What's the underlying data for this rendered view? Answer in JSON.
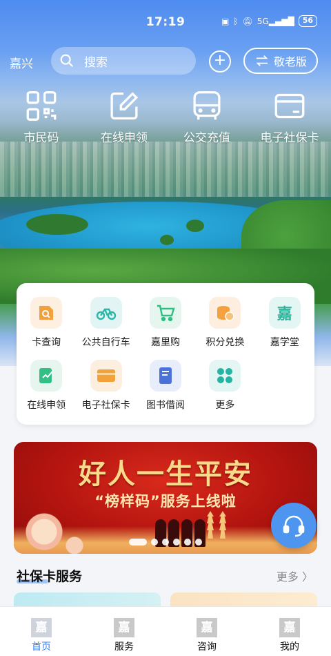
{
  "status_bar": {
    "time": "17:19",
    "icons": [
      "nfc-icon",
      "bluetooth-icon",
      "mute-icon",
      "5g-signal-icon"
    ],
    "battery": "56"
  },
  "top_nav": {
    "city": "嘉兴",
    "search": {
      "placeholder": "搜索"
    },
    "elder_mode_label": "敬老版"
  },
  "quick_actions": [
    {
      "label": "市民码",
      "icon": "qr-code-icon"
    },
    {
      "label": "在线申领",
      "icon": "edit-icon"
    },
    {
      "label": "公交充值",
      "icon": "bus-icon"
    },
    {
      "label": "电子社保卡",
      "icon": "card-icon"
    }
  ],
  "services": [
    {
      "label": "卡查询",
      "icon": "card-search-icon",
      "bg": "#fdf0e0",
      "color": "#f2a03d"
    },
    {
      "label": "公共自行车",
      "icon": "bicycle-icon",
      "bg": "#e2f5f4",
      "color": "#2bb6a8"
    },
    {
      "label": "嘉里购",
      "icon": "cart-icon",
      "bg": "#e6f6ee",
      "color": "#2fbf84"
    },
    {
      "label": "积分兑换",
      "icon": "coins-icon",
      "bg": "#fdeee0",
      "color": "#f4a23f"
    },
    {
      "label": "嘉学堂",
      "icon": "jia-logo-icon",
      "bg": "#e4f6f3",
      "color": "#2fb59c"
    },
    {
      "label": "在线申领",
      "icon": "edit-doc-icon",
      "bg": "#e6f6ee",
      "color": "#33bf86"
    },
    {
      "label": "电子社保卡",
      "icon": "wallet-card-icon",
      "bg": "#fdefe0",
      "color": "#f3a23a"
    },
    {
      "label": "图书借阅",
      "icon": "book-icon",
      "bg": "#e7edfb",
      "color": "#4a72d8"
    },
    {
      "label": "更多",
      "icon": "more-grid-icon",
      "bg": "#e3f6f3",
      "color": "#25b3a2"
    }
  ],
  "banner": {
    "title": "好人一生平安",
    "subtitle": "“榜样码”服务上线啦",
    "dots": 6,
    "active_dot": 0
  },
  "section": {
    "title": "社保卡服务",
    "more": "更多"
  },
  "tabs": [
    {
      "label": "首页",
      "logo": "嘉",
      "active": true
    },
    {
      "label": "服务",
      "logo": "嘉",
      "active": false
    },
    {
      "label": "咨询",
      "logo": "嘉",
      "active": false
    },
    {
      "label": "我的",
      "logo": "嘉",
      "active": false
    }
  ],
  "colors": {
    "accent": "#3a7ff0",
    "support_button": "#4e95ef",
    "banner_red": "#b3140f"
  }
}
